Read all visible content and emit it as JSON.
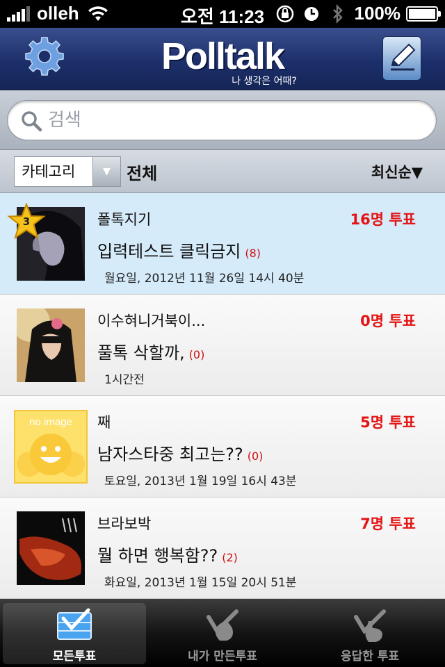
{
  "status_bar": {
    "carrier": "olleh",
    "time": "오전 11:23",
    "battery": "100%"
  },
  "header": {
    "logo_text": "Polltalk",
    "logo_subtitle": "나 생각은 어때?"
  },
  "search": {
    "placeholder": "검색"
  },
  "filter": {
    "category_label": "카테고리",
    "category_value": "전체",
    "sort_label": "최신순▼"
  },
  "polls": [
    {
      "author": "폴톡지기",
      "votes": "16명 투표",
      "title": "입력테스트 클릭금지",
      "comments": "(8)",
      "date": "월요일, 2012년 11월 26일 14시 40분",
      "rank": "3",
      "highlighted": true,
      "thumb_color": "#2a2a30"
    },
    {
      "author": "이수혀니거북이...",
      "votes": "0명 투표",
      "title": "풀톡 삭할까,",
      "comments": "(0)",
      "date": "1시간전",
      "highlighted": false,
      "thumb_color": "#c9a36a"
    },
    {
      "author": "째",
      "votes": "5명 투표",
      "title": "남자스타중 최고는??",
      "comments": "(0)",
      "date": "토요일, 2013년 1월 19일 16시 43분",
      "highlighted": false,
      "thumb_label": "no image",
      "thumb_color": "#fde16a"
    },
    {
      "author": "브라보박",
      "votes": "7명 투표",
      "title": "뭘 하면 행복함??",
      "comments": "(2)",
      "date": "화요일, 2013년 1월 15일 20시 51분",
      "highlighted": false,
      "thumb_color": "#7a2012"
    }
  ],
  "tabs": [
    {
      "label": "모든투표",
      "active": true
    },
    {
      "label": "내가 만든투표",
      "active": false
    },
    {
      "label": "응답한 투표",
      "active": false
    }
  ],
  "colors": {
    "header_bg": "#1d2f6b",
    "vote_red": "#e31414",
    "highlight_row": "#d6ebfa",
    "star_gold": "#f7c21c"
  }
}
